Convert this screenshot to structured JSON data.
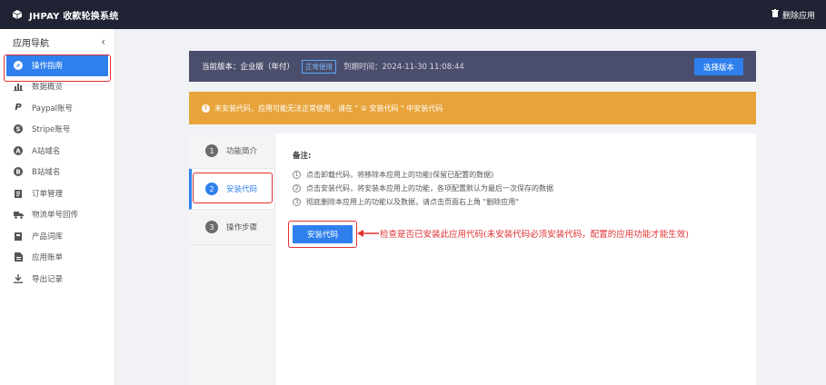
{
  "topbar": {
    "title": "JHPAY 收款轮换系统",
    "uninstall_label": "删除应用"
  },
  "sidebar": {
    "heading": "应用导航",
    "items": [
      {
        "label": "操作指南",
        "icon": "compass-icon"
      },
      {
        "label": "数据概览",
        "icon": "bar-chart-icon"
      },
      {
        "label": "Paypal账号",
        "icon": "paypal-icon"
      },
      {
        "label": "Stripe账号",
        "icon": "stripe-icon"
      },
      {
        "label": "A站域名",
        "icon": "letter-a-icon"
      },
      {
        "label": "B站域名",
        "icon": "letter-b-icon"
      },
      {
        "label": "订单管理",
        "icon": "clipboard-icon"
      },
      {
        "label": "物流单号回传",
        "icon": "truck-icon"
      },
      {
        "label": "产品词库",
        "icon": "book-icon"
      },
      {
        "label": "应用账单",
        "icon": "bill-icon"
      },
      {
        "label": "导出记录",
        "icon": "download-icon"
      }
    ]
  },
  "version": {
    "label": "当前版本：企业版（年付）",
    "badge": "正常使用",
    "expiry": "到期时间：2024-11-30 11:08:44",
    "select_button": "选择版本"
  },
  "warning": {
    "text": "未安装代码，应用可能无法正常使用，请在 \" ② 安装代码 \" 中安装代码"
  },
  "steps": [
    {
      "num": "1",
      "label": "功能简介"
    },
    {
      "num": "2",
      "label": "安装代码"
    },
    {
      "num": "3",
      "label": "操作步骤"
    }
  ],
  "notes": {
    "title": "备注:",
    "items": [
      {
        "num": "1",
        "text": "点击卸载代码，将移除本应用上的功能(保留已配置的数据)"
      },
      {
        "num": "2",
        "text": "点击安装代码，将安装本应用上的功能，各项配置默认为最后一次保存的数据"
      },
      {
        "num": "3",
        "text": "彻底删除本应用上的功能以及数据，请点击页面右上角 \"删除应用\""
      }
    ]
  },
  "install_button": "安装代码",
  "annotation": "检查是否已安装此应用代码(未安装代码必须安装代码，配置的应用功能才能生效)",
  "colors": {
    "topbar": "#1f2333",
    "primary": "#2f80ed",
    "warning": "#e8a43a",
    "version_bar": "#4a4d6b",
    "annotation_red": "#e03131"
  }
}
